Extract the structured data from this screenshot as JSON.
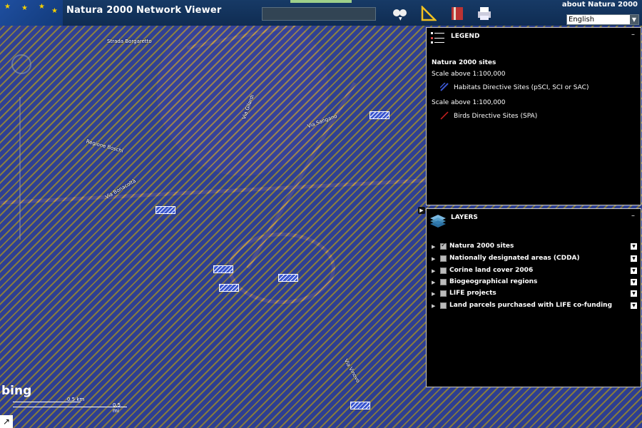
{
  "header": {
    "title": "Natura 2000 Network Viewer",
    "about_link": "about Natura 2000",
    "language": "English",
    "search_value": ""
  },
  "map": {
    "labels": [
      "Strada Borgaretto",
      "Via Sangano",
      "Regione Boschi",
      "Via Bonacoltà",
      "Via Vinovo",
      "Via Gilardi"
    ],
    "scale_top": "0.5 km",
    "scale_bottom": "0.5 mi",
    "logo": "bing"
  },
  "legend": {
    "title": "LEGEND",
    "section": "Natura 2000 sites",
    "scale1": "Scale above 1:100,000",
    "item1": "Habitats Directive Sites (pSCI, SCI or SAC)",
    "scale2": "Scale above 1:100,000",
    "item2": "Birds Directive Sites (SPA)",
    "colors": {
      "habitats": "#3a56d0",
      "birds": "#d02020"
    }
  },
  "layers": {
    "title": "LAYERS",
    "items": [
      {
        "label": "Natura 2000 sites",
        "checked": true
      },
      {
        "label": "Nationally designated areas (CDDA)",
        "checked": false
      },
      {
        "label": "Corine land cover 2006",
        "checked": false
      },
      {
        "label": "Biogeographical regions",
        "checked": false
      },
      {
        "label": "LIFE projects",
        "checked": false
      },
      {
        "label": "Land parcels purchased with LIFE co-funding",
        "checked": false
      }
    ]
  }
}
